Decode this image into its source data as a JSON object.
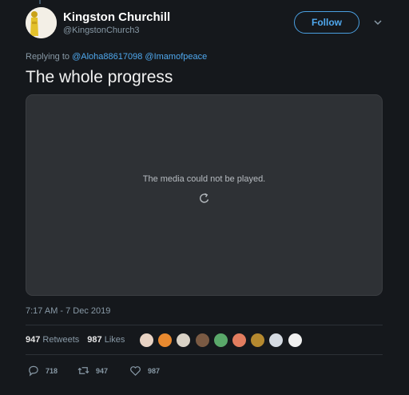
{
  "author": {
    "display_name": "Kingston Churchill",
    "handle": "@KingstonChurch3"
  },
  "follow_label": "Follow",
  "reply": {
    "prefix": "Replying to",
    "mentions": [
      "@Aloha88617098",
      "@Imamofpeace"
    ]
  },
  "tweet_text": "The whole progress",
  "media": {
    "message": "The media could not be played."
  },
  "timestamp": "7:17 AM - 7 Dec 2019",
  "stats": {
    "retweets_count": "947",
    "retweets_label": "Retweets",
    "likes_count": "987",
    "likes_label": "Likes"
  },
  "liker_avatars": [
    {
      "name": "avatar-1",
      "color": "#e8d3c4"
    },
    {
      "name": "avatar-2",
      "color": "#e8892f"
    },
    {
      "name": "avatar-3",
      "color": "#d9d2c6"
    },
    {
      "name": "avatar-4",
      "color": "#7a5a43"
    },
    {
      "name": "avatar-5",
      "color": "#5aa86a"
    },
    {
      "name": "avatar-6",
      "color": "#e27d5f"
    },
    {
      "name": "avatar-7",
      "color": "#b5892f"
    },
    {
      "name": "avatar-8",
      "color": "#d5dbe2"
    },
    {
      "name": "avatar-9",
      "color": "#f0f0f0"
    }
  ],
  "actions": {
    "replies": "718",
    "retweets": "947",
    "likes": "987"
  },
  "colors": {
    "background": "#15181c",
    "accent": "#4fa8ee",
    "muted": "#8899a6"
  }
}
